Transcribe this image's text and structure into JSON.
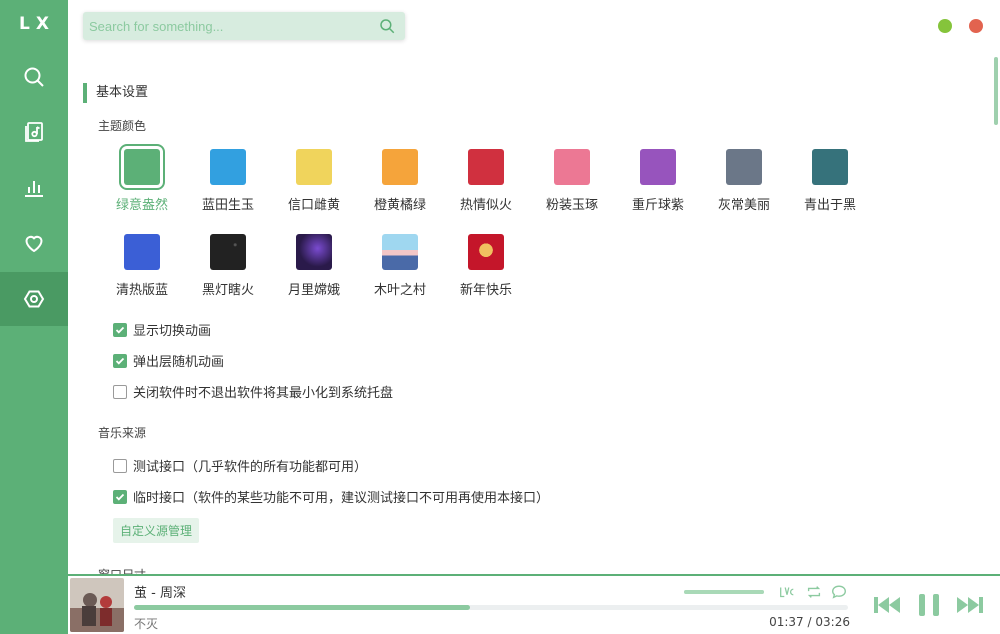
{
  "app": {
    "logo": "LX"
  },
  "sidebar": {
    "items": [
      {
        "id": "search",
        "icon": "search-icon"
      },
      {
        "id": "songlist",
        "icon": "music-file-icon"
      },
      {
        "id": "leaderboard",
        "icon": "bar-chart-icon"
      },
      {
        "id": "favorites",
        "icon": "heart-icon"
      },
      {
        "id": "settings",
        "icon": "settings-icon",
        "active": true
      }
    ]
  },
  "search": {
    "placeholder": "Search for something..."
  },
  "settings": {
    "section_title": "基本设置",
    "theme_label": "主题颜色",
    "themes": [
      {
        "name": "绿意盎然",
        "color": "#5cb077",
        "active": true
      },
      {
        "name": "蓝田生玉",
        "color": "#32a0e0"
      },
      {
        "name": "信口雌黄",
        "color": "#f0d45c"
      },
      {
        "name": "橙黄橘绿",
        "color": "#f5a43b"
      },
      {
        "name": "热情似火",
        "color": "#d0303f"
      },
      {
        "name": "粉装玉琢",
        "color": "#ec7894"
      },
      {
        "name": "重斤球紫",
        "color": "#9754bd"
      },
      {
        "name": "灰常美丽",
        "color": "#6b7788"
      },
      {
        "name": "青出于黑",
        "color": "#36727b"
      },
      {
        "name": "清热版蓝",
        "color": "#3b5fd6"
      },
      {
        "name": "黑灯瞎火",
        "color": "#222222"
      },
      {
        "name": "月里嫦娥",
        "color": "#2a1a4a"
      },
      {
        "name": "木叶之村",
        "color": "#8cc9e8"
      },
      {
        "name": "新年快乐",
        "color": "#c4162a"
      }
    ],
    "options": [
      {
        "label": "显示切换动画",
        "checked": true
      },
      {
        "label": "弹出层随机动画",
        "checked": true
      },
      {
        "label": "关闭软件时不退出软件将其最小化到系统托盘",
        "checked": false
      }
    ],
    "source_label": "音乐来源",
    "sources": [
      {
        "label": "测试接口（几乎软件的所有功能都可用）",
        "checked": false
      },
      {
        "label": "临时接口（软件的某些功能不可用，建议测试接口不可用再使用本接口）",
        "checked": true
      }
    ],
    "custom_source_button": "自定义源管理",
    "next_section": "窗口尺寸"
  },
  "player": {
    "title": "茧 - 周深",
    "lyric": "不灭",
    "current_time": "01:37",
    "total_time": "03:26",
    "time_separator": "/",
    "progress": 0.47,
    "volume": 1.0,
    "icons": [
      "lyric-icon",
      "repeat-icon",
      "comment-icon",
      "prev-icon",
      "pause-icon",
      "next-icon"
    ],
    "accent": "#5cb077"
  }
}
